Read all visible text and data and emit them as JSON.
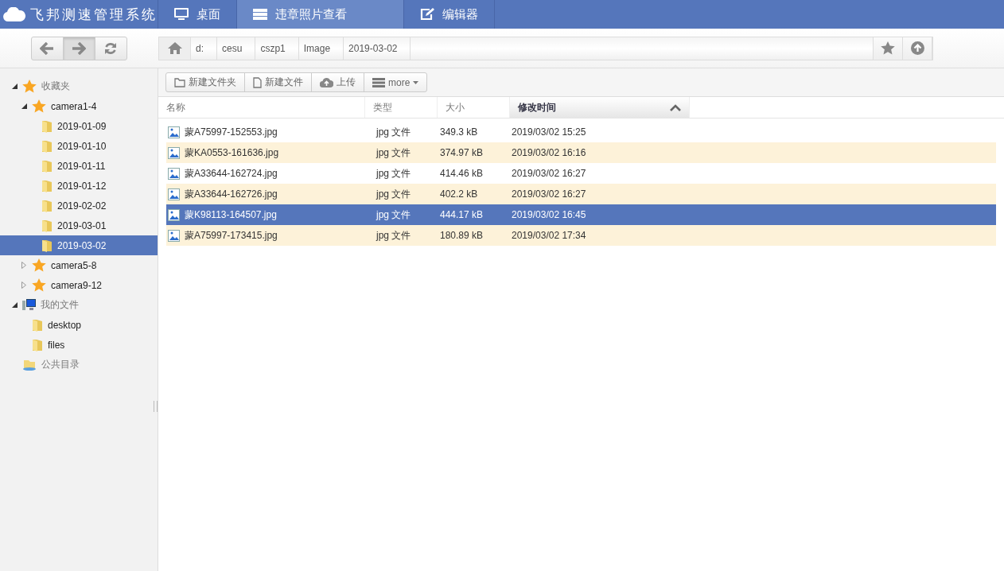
{
  "app_title": "飞邦测速管理系统",
  "tabs": [
    {
      "kind": "monitor",
      "label": "桌面",
      "selected": false
    },
    {
      "kind": "list",
      "label": "违章照片查看",
      "selected": true
    },
    {
      "kind": "edit",
      "label": "编辑器",
      "selected": false
    }
  ],
  "nav_buttons": [
    {
      "kind": "back",
      "pressed": false
    },
    {
      "kind": "forward",
      "pressed": true
    },
    {
      "kind": "refresh",
      "pressed": false
    }
  ],
  "breadcrumb": [
    "d:",
    "cesu",
    "cszp1",
    "Image",
    "2019-03-02"
  ],
  "tree": [
    {
      "kind": "star",
      "label": "收藏夹",
      "expanded": true,
      "selected": false,
      "children": [
        {
          "kind": "star",
          "label": "camera1-4",
          "expanded": true,
          "selected": false,
          "children": [
            {
              "kind": "folder",
              "label": "2019-01-09",
              "selected": false
            },
            {
              "kind": "folder",
              "label": "2019-01-10",
              "selected": false
            },
            {
              "kind": "folder",
              "label": "2019-01-11",
              "selected": false
            },
            {
              "kind": "folder",
              "label": "2019-01-12",
              "selected": false
            },
            {
              "kind": "folder",
              "label": "2019-02-02",
              "selected": false
            },
            {
              "kind": "folder",
              "label": "2019-03-01",
              "selected": false
            },
            {
              "kind": "folder",
              "label": "2019-03-02",
              "selected": true
            }
          ]
        },
        {
          "kind": "star",
          "label": "camera5-8",
          "expanded": false,
          "selected": false
        },
        {
          "kind": "star",
          "label": "camera9-12",
          "expanded": false,
          "selected": false
        }
      ]
    },
    {
      "kind": "computer",
      "label": "我的文件",
      "expanded": true,
      "selected": false,
      "children": [
        {
          "kind": "folder",
          "label": "desktop",
          "selected": false
        },
        {
          "kind": "folder",
          "label": "files",
          "selected": false
        }
      ]
    },
    {
      "kind": "shared",
      "label": "公共目录",
      "selected": false
    }
  ],
  "toolbar": [
    {
      "kind": "folder",
      "label": "新建文件夹"
    },
    {
      "kind": "file",
      "label": "新建文件"
    },
    {
      "kind": "upload",
      "label": "上传"
    },
    {
      "kind": "more",
      "label": "more"
    }
  ],
  "columns": [
    {
      "label": "名称",
      "sorted": false
    },
    {
      "label": "类型",
      "sorted": false
    },
    {
      "label": "大小",
      "sorted": false
    },
    {
      "label": "修改时间",
      "sorted": true
    }
  ],
  "rows": [
    {
      "name": "蒙A75997-152553.jpg",
      "type": "jpg 文件",
      "size": "349.3 kB",
      "modified": "2019/03/02 15:25",
      "selected": false
    },
    {
      "name": "蒙KA0553-161636.jpg",
      "type": "jpg 文件",
      "size": "374.97 kB",
      "modified": "2019/03/02 16:16",
      "selected": false
    },
    {
      "name": "蒙A33644-162724.jpg",
      "type": "jpg 文件",
      "size": "414.46 kB",
      "modified": "2019/03/02 16:27",
      "selected": false
    },
    {
      "name": "蒙A33644-162726.jpg",
      "type": "jpg 文件",
      "size": "402.2 kB",
      "modified": "2019/03/02 16:27",
      "selected": false
    },
    {
      "name": "蒙K98113-164507.jpg",
      "type": "jpg 文件",
      "size": "444.17 kB",
      "modified": "2019/03/02 16:45",
      "selected": true
    },
    {
      "name": "蒙A75997-173415.jpg",
      "type": "jpg 文件",
      "size": "180.89 kB",
      "modified": "2019/03/02 17:34",
      "selected": false
    }
  ]
}
